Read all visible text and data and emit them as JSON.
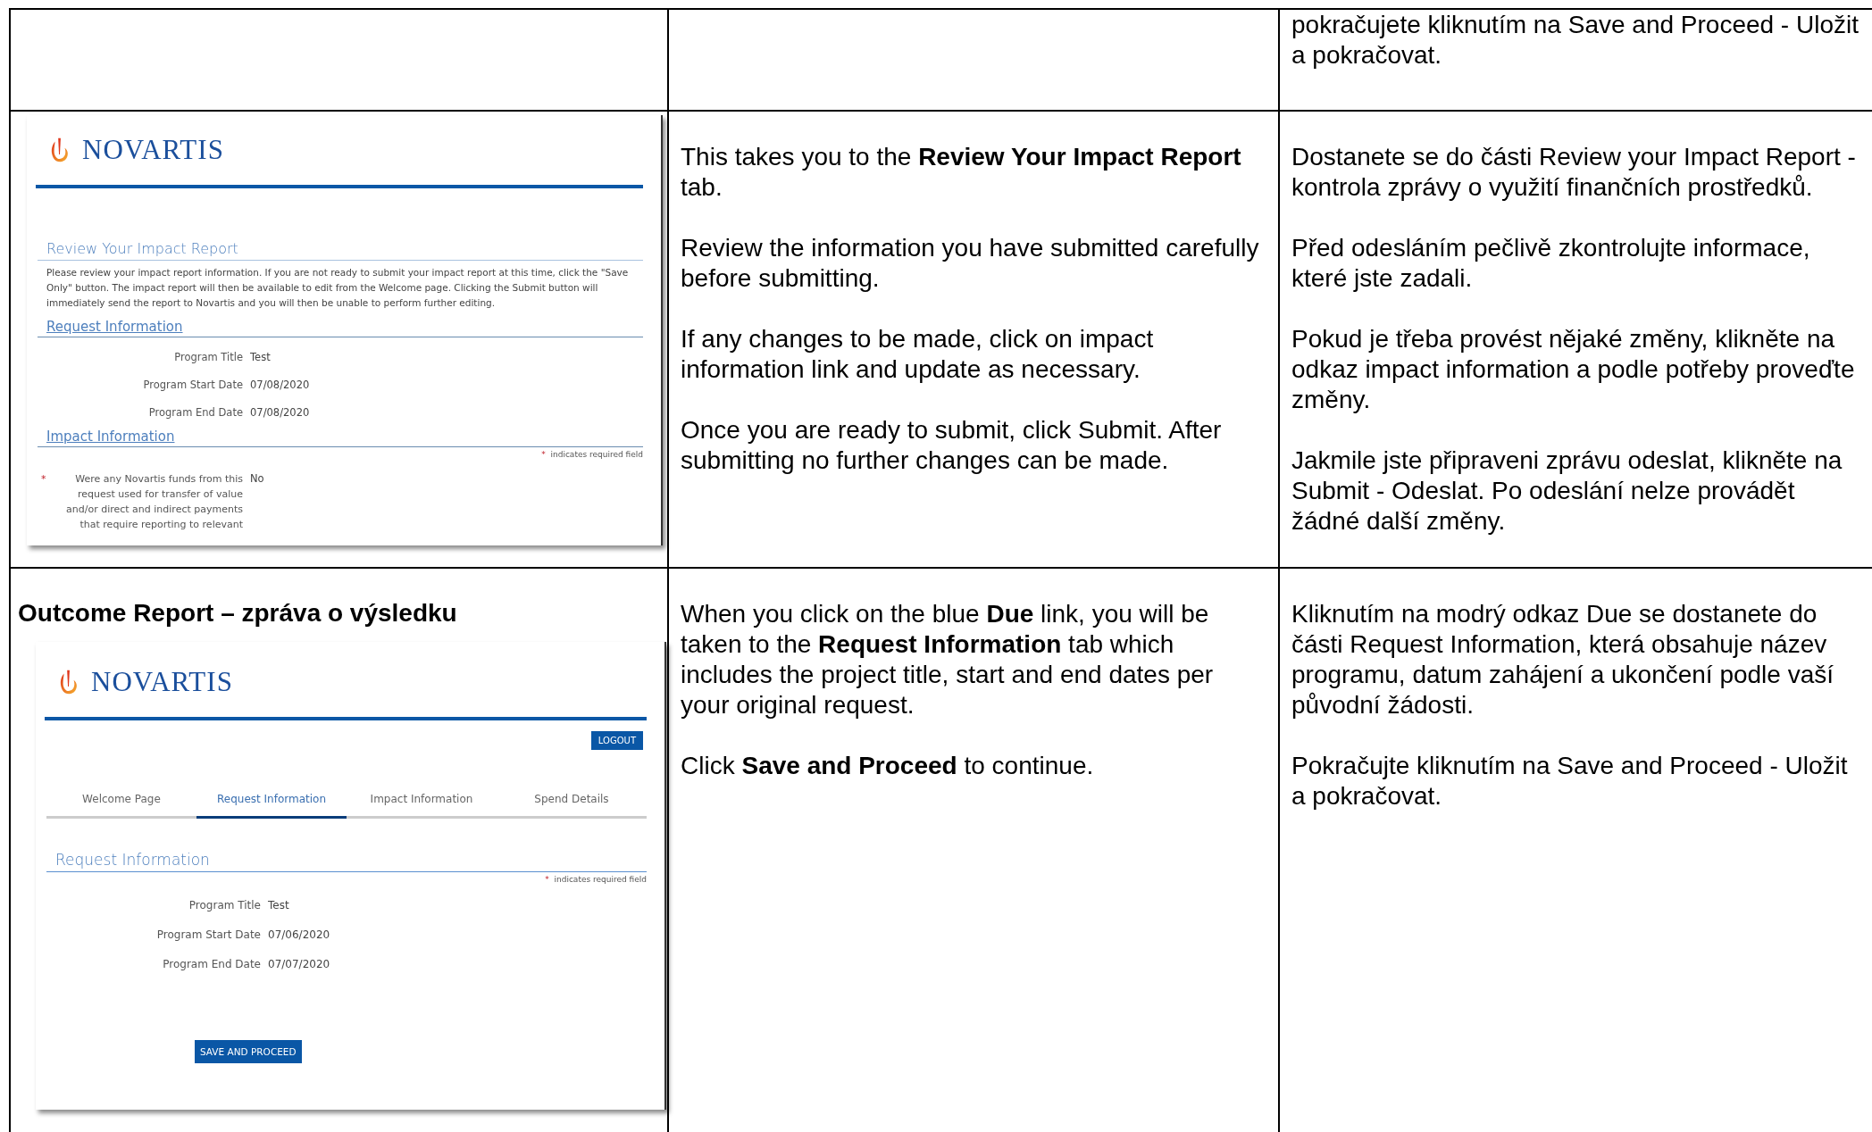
{
  "table": {
    "rows": [
      {
        "heading": "",
        "screenshot": null,
        "instructions_en": [],
        "instructions_cs": [
          "pokračujete kliknutím na Save and Proceed - Uložit a pokračovat."
        ]
      },
      {
        "heading": "",
        "screenshot": {
          "blocks": [
            {
              "kind": "logo",
              "text": "NOVARTIS"
            },
            {
              "kind": "title",
              "text": "Review Your Impact Report"
            },
            {
              "kind": "paragraph",
              "text": "Please review your impact report information. If you are not ready to submit your impact report at this time, click the \"Save Only\" button. The impact report will then be available to edit from the Welcome page. Clicking the Submit button will immediately send the report to Novartis and you will then be unable to perform further editing."
            },
            {
              "kind": "section_link",
              "text": "Request Information"
            },
            {
              "kind": "field",
              "label": "Program Title",
              "value": "Test"
            },
            {
              "kind": "field",
              "label": "Program Start Date",
              "value": "07/08/2020"
            },
            {
              "kind": "field",
              "label": "Program End Date",
              "value": "07/08/2020"
            },
            {
              "kind": "section_link",
              "text": "Impact Information"
            },
            {
              "kind": "required_note",
              "mark": "*",
              "text": "indicates required field"
            },
            {
              "kind": "field",
              "marker": "*",
              "label": "Were any Novartis funds from this request used for transfer of value and/or direct and indirect payments that require reporting to relevant",
              "value": "No"
            }
          ]
        },
        "instructions_en": [
          "This takes you to the **Review Your Impact Report** tab.",
          "Review the information you have submitted carefully before submitting.",
          "If any changes to be made, click on impact information link and update as necessary.",
          "Once you are ready to submit, click Submit. After submitting no further changes can be made."
        ],
        "instructions_cs": [
          "Dostanete se do části Review your Impact Report -  kontrola zprávy o využití finančních prostředků.",
          "Před odesláním pečlivě zkontrolujte informace, které jste zadali.",
          "Pokud je třeba provést nějaké změny, klikněte na odkaz impact information a podle potřeby proveďte změny.",
          "Jakmile jste připraveni zprávu odeslat, klikněte na Submit - Odeslat. Po odeslání nelze provádět žádné další změny."
        ]
      },
      {
        "heading": "Outcome Report – zpráva o výsledku",
        "screenshot": {
          "blocks": [
            {
              "kind": "logo",
              "text": "NOVARTIS"
            },
            {
              "kind": "logout_button",
              "text": "LOGOUT"
            },
            {
              "kind": "tabs",
              "tabs": [
                {
                  "label": "Welcome Page",
                  "selected": false
                },
                {
                  "label": "Request Information",
                  "selected": true
                },
                {
                  "label": "Impact Information",
                  "selected": false
                },
                {
                  "label": "Spend Details",
                  "selected": false
                }
              ]
            },
            {
              "kind": "title",
              "text": "Request Information"
            },
            {
              "kind": "required_note",
              "mark": "*",
              "text": "indicates required field"
            },
            {
              "kind": "field",
              "label": "Program Title",
              "value": "Test"
            },
            {
              "kind": "field",
              "label": "Program Start Date",
              "value": "07/06/2020"
            },
            {
              "kind": "field",
              "label": "Program End Date",
              "value": "07/07/2020"
            },
            {
              "kind": "primary_button",
              "text": "SAVE AND PROCEED"
            }
          ]
        },
        "instructions_en": [
          "When you click on the blue **Due** link, you will be taken to the **Request Information** tab which includes the project title, start and end dates per your original request.",
          "Click **Save and Proceed** to continue."
        ],
        "instructions_cs": [
          "Kliknutím na modrý odkaz Due se dostanete do části Request Information, která obsahuje název programu, datum zahájení a ukončení podle vaší původní žádosti.",
          "Pokračujte kliknutím na Save and Proceed - Uložit a pokračovat."
        ]
      }
    ]
  }
}
